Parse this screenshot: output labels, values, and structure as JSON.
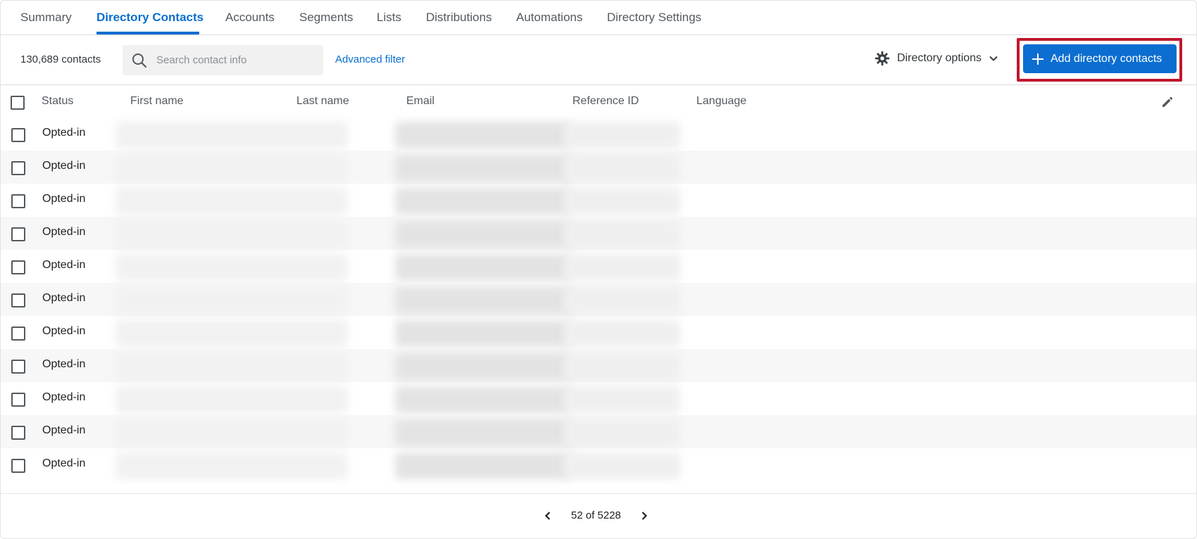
{
  "tabs": [
    {
      "label": "Summary"
    },
    {
      "label": "Directory Contacts"
    },
    {
      "label": "Accounts"
    },
    {
      "label": "Segments"
    },
    {
      "label": "Lists"
    },
    {
      "label": "Distributions"
    },
    {
      "label": "Automations"
    },
    {
      "label": "Directory Settings"
    }
  ],
  "active_tab": "Directory Contacts",
  "toolbar": {
    "contact_count": "130,689 contacts",
    "search_placeholder": "Search contact info",
    "advanced_filter": "Advanced filter",
    "directory_options": "Directory options",
    "add_button": "Add directory contacts"
  },
  "table": {
    "columns": [
      "Status",
      "First name",
      "Last name",
      "Email",
      "Reference ID",
      "Language"
    ],
    "rows": [
      {
        "status": "Opted-in"
      },
      {
        "status": "Opted-in"
      },
      {
        "status": "Opted-in"
      },
      {
        "status": "Opted-in"
      },
      {
        "status": "Opted-in"
      },
      {
        "status": "Opted-in"
      },
      {
        "status": "Opted-in"
      },
      {
        "status": "Opted-in"
      },
      {
        "status": "Opted-in"
      },
      {
        "status": "Opted-in"
      },
      {
        "status": "Opted-in"
      }
    ]
  },
  "pagination": {
    "label": "52 of 5228"
  },
  "colors": {
    "accent": "#0b6ed0",
    "highlight": "#c0172d"
  },
  "icons": [
    "search-icon",
    "gear-icon",
    "chevron-down-icon",
    "plus-icon",
    "pencil-icon",
    "chevron-left-icon",
    "chevron-right-icon"
  ]
}
